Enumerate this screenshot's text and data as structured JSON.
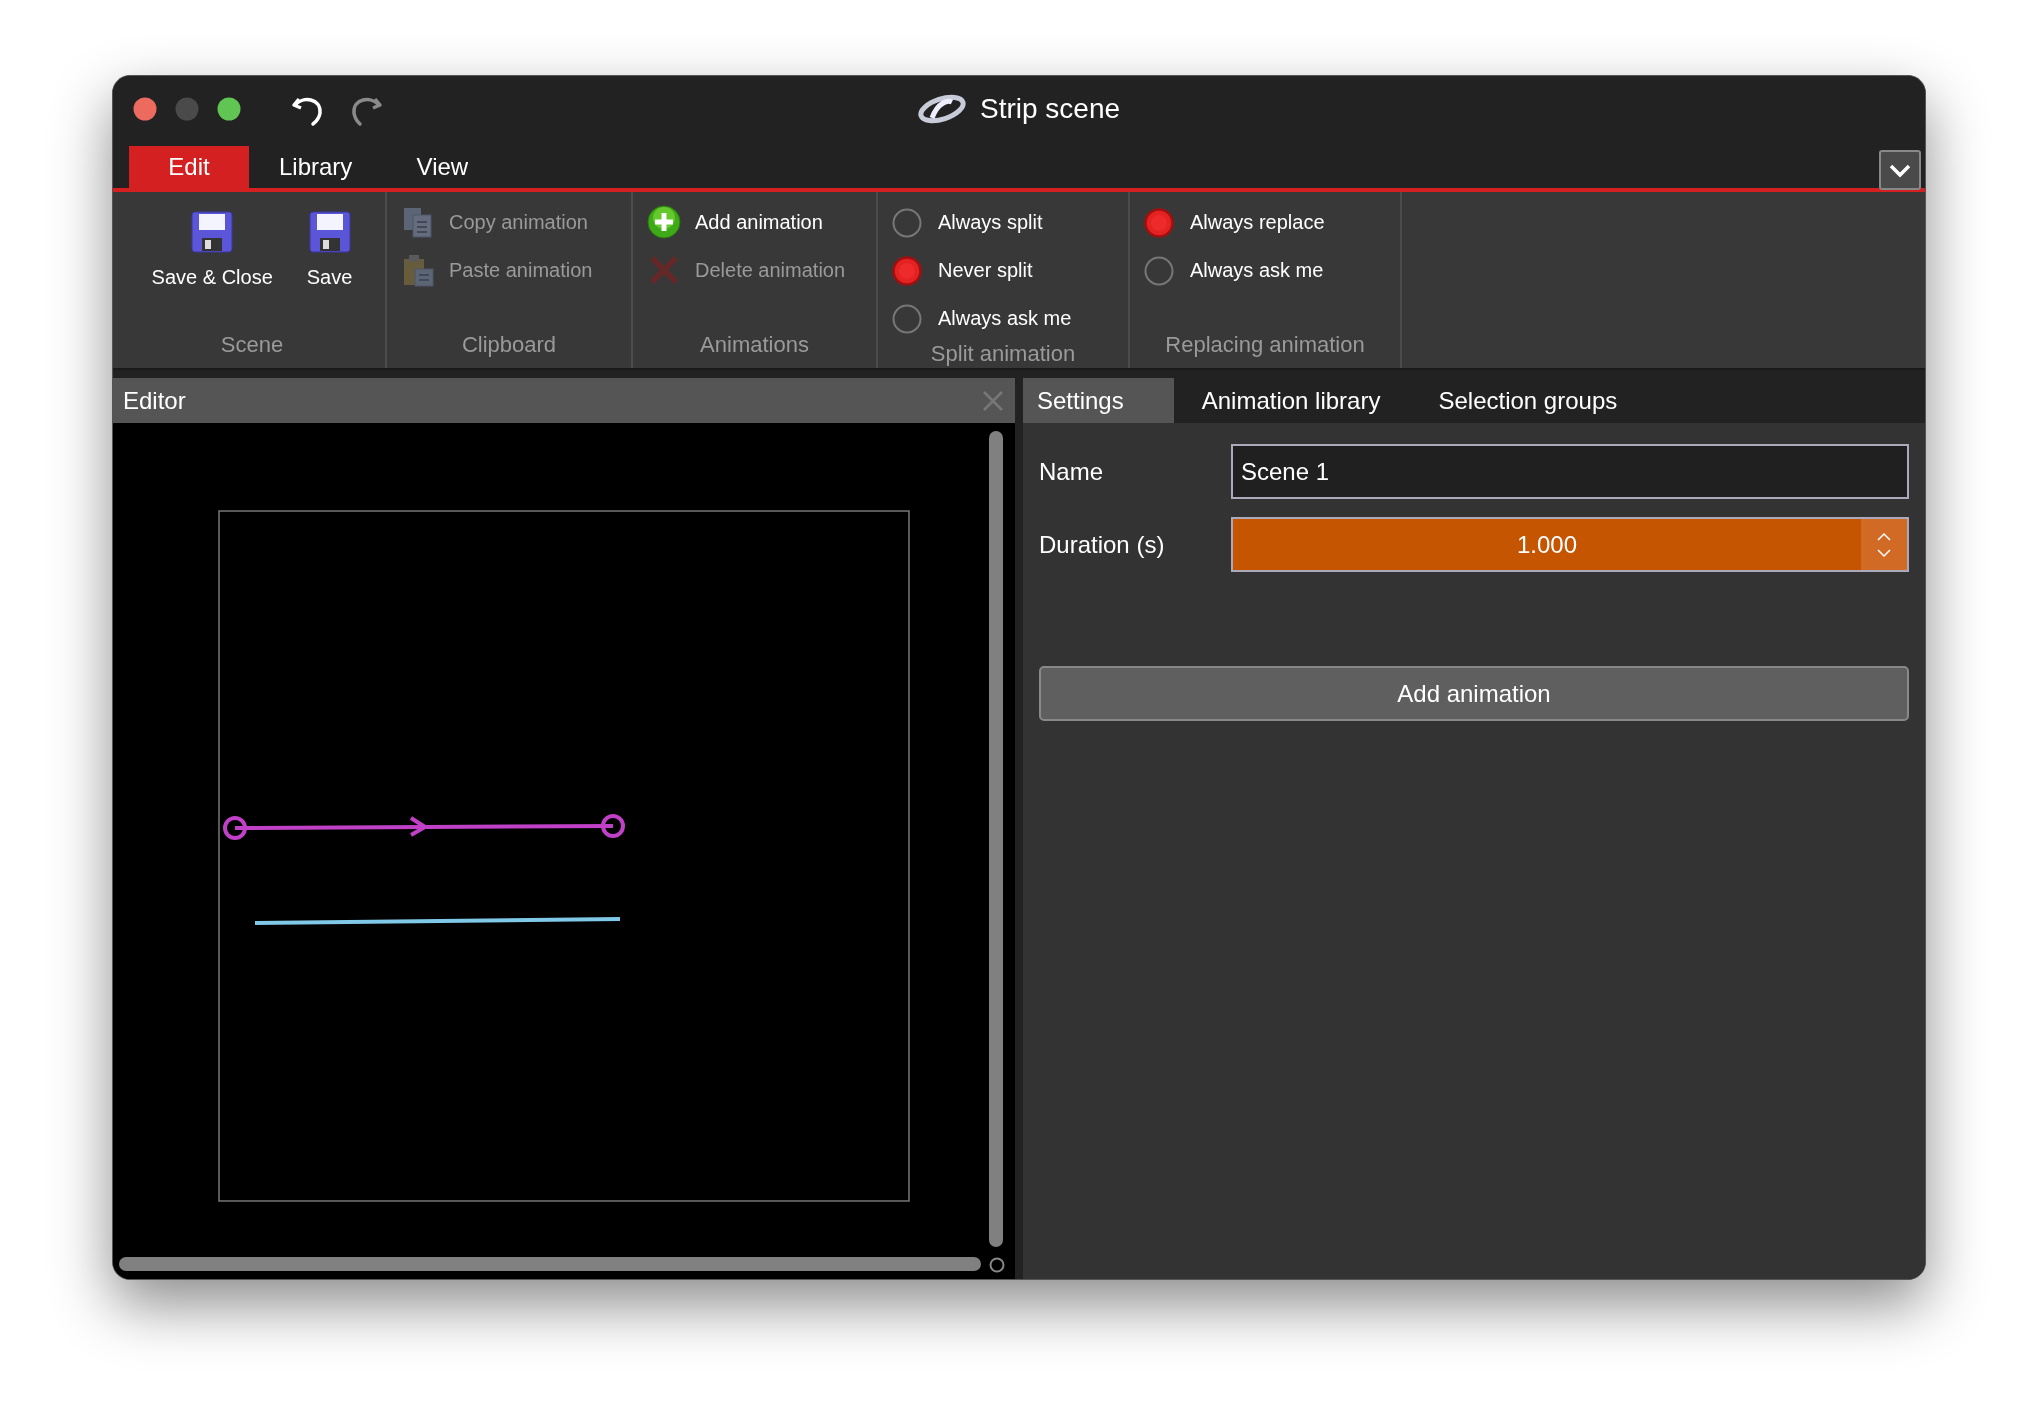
{
  "window": {
    "title": "Strip scene"
  },
  "history_buttons": [
    {
      "kind": "undo",
      "disabled": false
    },
    {
      "kind": "redo",
      "disabled": true
    }
  ],
  "menu_tabs": [
    {
      "label": "Edit",
      "selected": true
    },
    {
      "label": "Library",
      "selected": false
    },
    {
      "label": "View",
      "selected": false
    }
  ],
  "ribbon": {
    "groups": [
      {
        "label": "Scene",
        "kind": "big_buttons",
        "items": [
          {
            "label": "Save & Close",
            "disabled": false
          },
          {
            "label": "Save",
            "disabled": false
          }
        ]
      },
      {
        "label": "Clipboard",
        "kind": "small_buttons",
        "items": [
          {
            "label": "Copy animation",
            "disabled": true
          },
          {
            "label": "Paste animation",
            "disabled": true
          }
        ]
      },
      {
        "label": "Animations",
        "kind": "small_buttons",
        "items": [
          {
            "label": "Add animation",
            "disabled": false
          },
          {
            "label": "Delete animation",
            "disabled": true
          }
        ]
      },
      {
        "label": "Split animation",
        "kind": "radios",
        "items": [
          {
            "label": "Always split",
            "selected": false
          },
          {
            "label": "Never split",
            "selected": true
          },
          {
            "label": "Always ask me",
            "selected": false
          }
        ]
      },
      {
        "label": "Replacing animation",
        "kind": "radios",
        "items": [
          {
            "label": "Always replace",
            "selected": true
          },
          {
            "label": "Always ask me",
            "selected": false
          }
        ]
      }
    ]
  },
  "editor": {
    "title": "Editor"
  },
  "settings": {
    "tabs": [
      {
        "label": "Settings",
        "selected": true
      },
      {
        "label": "Animation library",
        "selected": false
      },
      {
        "label": "Selection groups",
        "selected": false
      }
    ],
    "fields": [
      {
        "label": "Name",
        "kind": "text",
        "value": "Scene 1"
      },
      {
        "label": "Duration (s)",
        "kind": "spin",
        "value": "1.000"
      }
    ],
    "button": "Add animation"
  }
}
